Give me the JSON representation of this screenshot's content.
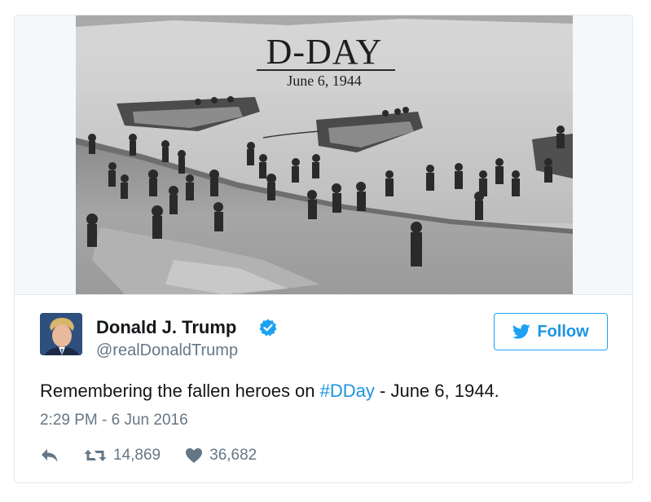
{
  "media": {
    "headline": "D-DAY",
    "date_caption": "June 6, 1944"
  },
  "author": {
    "display_name": "Donald J. Trump",
    "handle": "@realDonaldTrump",
    "verified": true,
    "avatar_icon": "profile-photo"
  },
  "follow": {
    "label": "Follow",
    "icon": "twitter-bird-icon",
    "color": "#1da1f2"
  },
  "tweet": {
    "text_before": "Remembering the fallen heroes on ",
    "hashtag": "#DDay",
    "text_after": " - June 6, 1944.",
    "timestamp": "2:29 PM - 6 Jun 2016"
  },
  "actions": {
    "reply_icon": "reply-icon",
    "retweet_icon": "retweet-icon",
    "retweet_count": "14,869",
    "like_icon": "heart-icon",
    "like_count": "36,682"
  },
  "colors": {
    "link": "#1b95e0",
    "text": "#14171a",
    "muted": "#657786",
    "border": "#e1e8ed"
  }
}
